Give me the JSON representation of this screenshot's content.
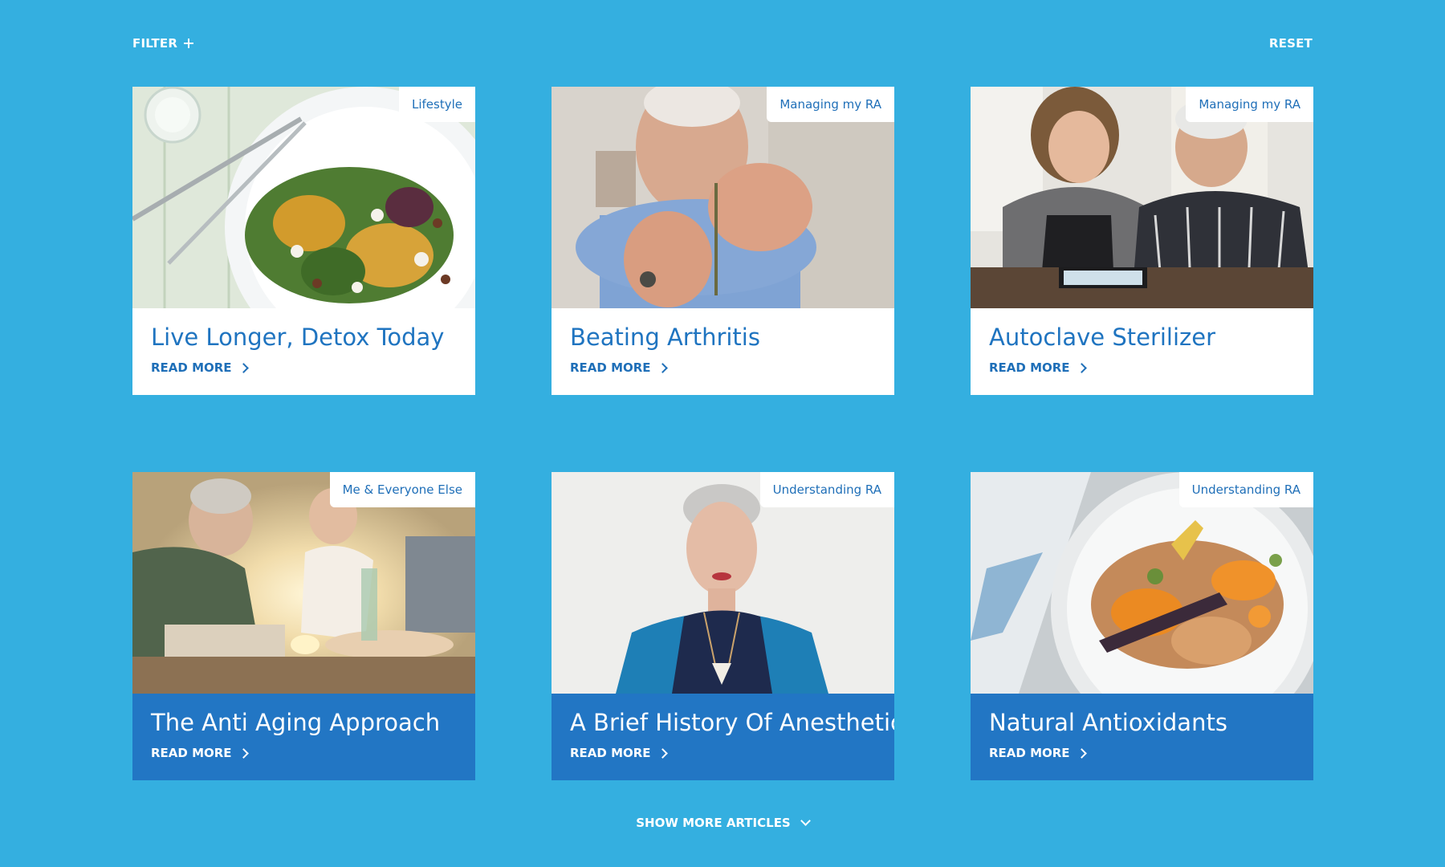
{
  "toolbar": {
    "filter_label": "FILTER",
    "reset_label": "RESET"
  },
  "articles": [
    {
      "tag": "Lifestyle",
      "title": "Live Longer, Detox Today",
      "read_more": "READ MORE",
      "image": "salad-plate"
    },
    {
      "tag": "Managing my RA",
      "title": "Beating Arthritis",
      "read_more": "READ MORE",
      "image": "elderly-man-hands"
    },
    {
      "tag": "Managing my RA",
      "title": "Autoclave Sterilizer",
      "read_more": "READ MORE",
      "image": "couple-with-tablet"
    },
    {
      "tag": "Me & Everyone Else",
      "title": "The Anti Aging Approach",
      "read_more": "READ MORE",
      "image": "couple-on-dock"
    },
    {
      "tag": "Understanding RA",
      "title": "A Brief History Of Anesthetics",
      "read_more": "READ MORE",
      "image": "woman-portrait"
    },
    {
      "tag": "Understanding RA",
      "title": "Natural Antioxidants",
      "read_more": "READ MORE",
      "image": "carrot-dish"
    }
  ],
  "show_more_label": "SHOW MORE ARTICLES",
  "colors": {
    "background": "#34afe0",
    "accent_blue": "#2276c4",
    "card_white": "#ffffff"
  }
}
